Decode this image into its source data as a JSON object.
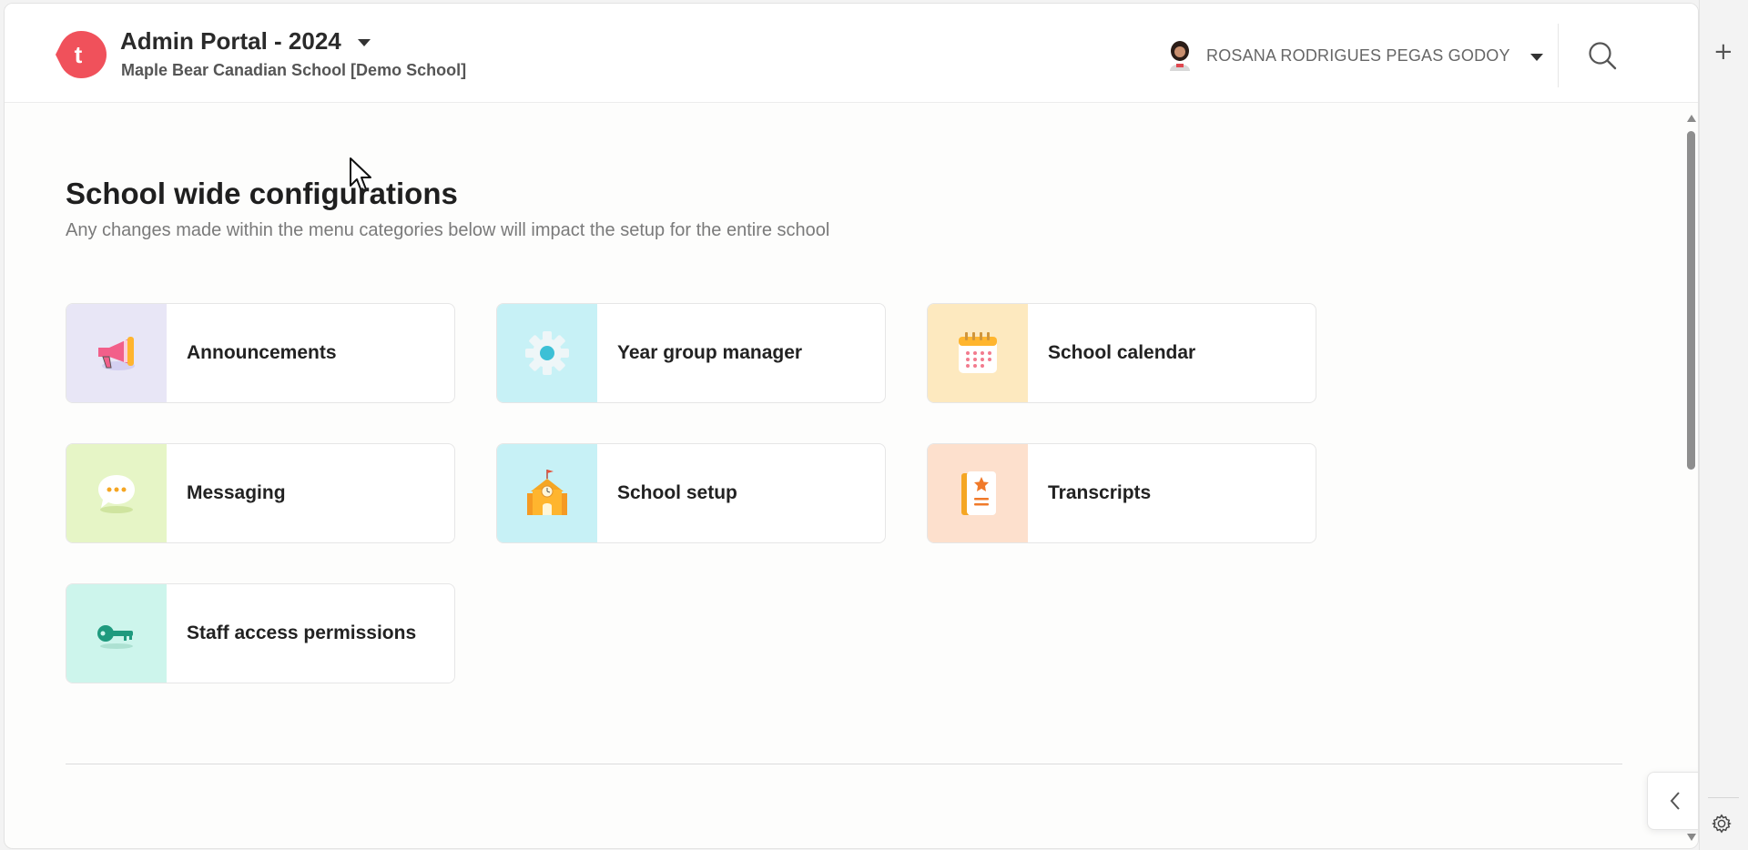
{
  "header": {
    "portal_title": "Admin Portal - 2024",
    "school_name": "Maple Bear Canadian School [Demo School]",
    "logo_letter": "t",
    "user_name": "ROSANA RODRIGUES PEGAS GODOY",
    "brand_color": "#f0515b"
  },
  "main": {
    "title": "School wide configurations",
    "subtitle": "Any changes made within the menu categories below will impact the setup for the entire school"
  },
  "cards": [
    {
      "label": "Announcements",
      "icon": "megaphone-icon",
      "tile_color": "#e8e6f6"
    },
    {
      "label": "Year group manager",
      "icon": "gear-icon",
      "tile_color": "#c7f1f6"
    },
    {
      "label": "School calendar",
      "icon": "calendar-icon",
      "tile_color": "#fde9bf"
    },
    {
      "label": "Messaging",
      "icon": "chat-bubble-icon",
      "tile_color": "#e6f5c6"
    },
    {
      "label": "School setup",
      "icon": "school-building-icon",
      "tile_color": "#c7f1f6"
    },
    {
      "label": "Transcripts",
      "icon": "transcript-book-icon",
      "tile_color": "#fde0cd"
    },
    {
      "label": "Staff access permissions",
      "icon": "key-icon",
      "tile_color": "#cdf5ec"
    }
  ],
  "rail": {
    "plus": "+"
  }
}
